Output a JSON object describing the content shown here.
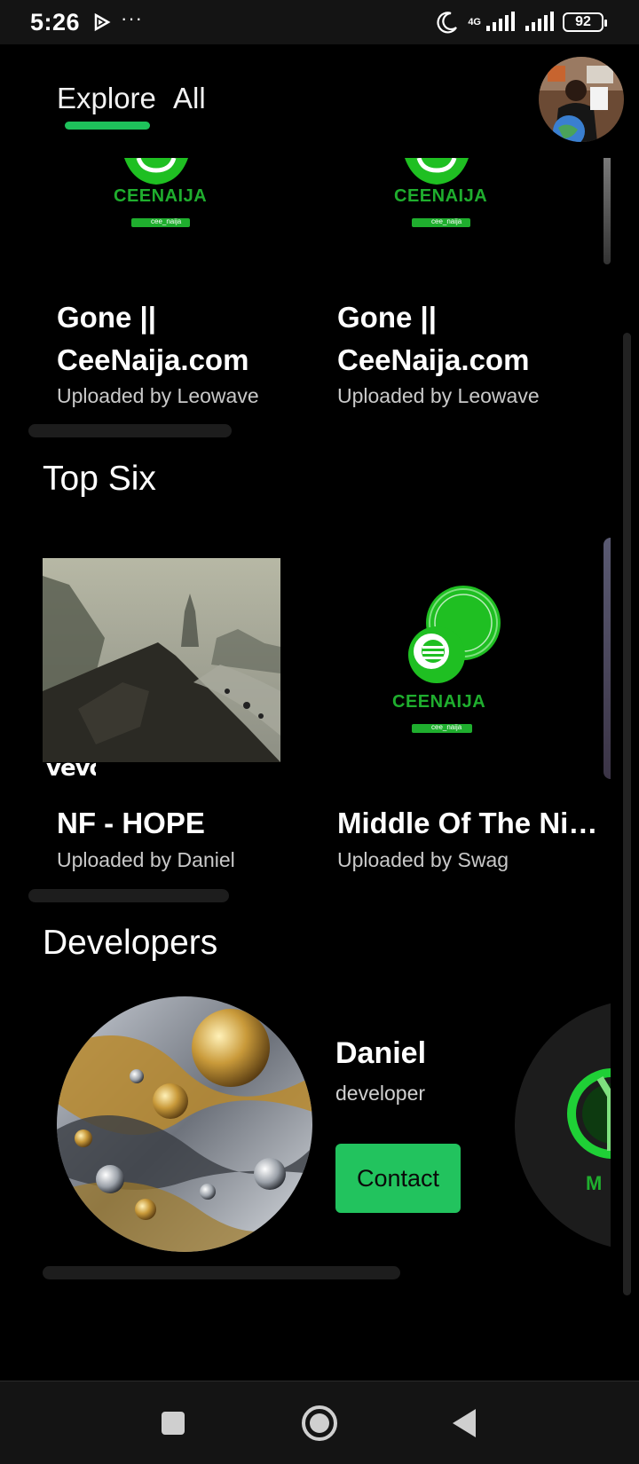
{
  "status_bar": {
    "time": "5:26",
    "dots": "···",
    "network": "4G",
    "battery": "92",
    "icons": [
      "play-icon",
      "moon-icon",
      "signal-icon",
      "signal-icon",
      "battery-icon"
    ]
  },
  "nav": {
    "tabs": [
      {
        "label": "Explore",
        "active": true
      },
      {
        "label": "All",
        "active": false
      }
    ],
    "accent": "#1ec25b"
  },
  "first_row": {
    "cards": [
      {
        "title_line1": "Gone ||",
        "title_line2": "CeeNaija.com",
        "subtitle": "Uploaded by Leowave",
        "logo_text": "CEENAIJA",
        "logo_handle": "cee_naija"
      },
      {
        "title_line1": "Gone ||",
        "title_line2": "CeeNaija.com",
        "subtitle": "Uploaded by Leowave",
        "logo_text": "CEENAIJA",
        "logo_handle": "cee_naija"
      }
    ]
  },
  "top_six": {
    "title": "Top Six",
    "cards": [
      {
        "title": "NF - HOPE",
        "subtitle": "Uploaded by Daniel",
        "watermark": "vevo"
      },
      {
        "title": "Middle Of The Ni…",
        "subtitle": "Uploaded by Swag",
        "logo_text": "CEENAIJA",
        "logo_handle": "cee_naija"
      }
    ]
  },
  "developers": {
    "title": "Developers",
    "items": [
      {
        "name": "Daniel",
        "role": "developer",
        "contact_label": "Contact"
      }
    ],
    "next_peek_text": "M"
  },
  "navbar": {
    "icons": [
      "recent-apps-icon",
      "home-icon",
      "back-icon"
    ]
  }
}
